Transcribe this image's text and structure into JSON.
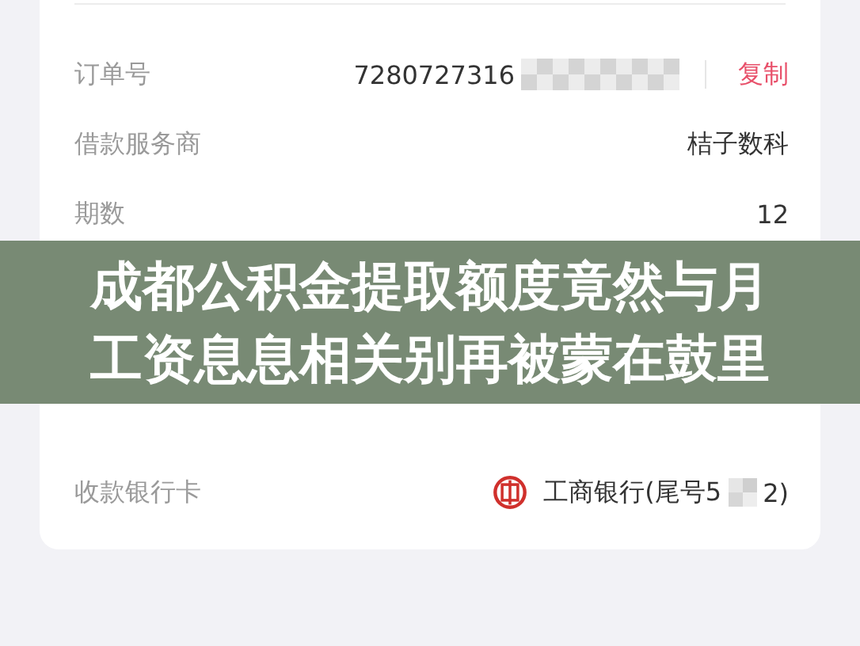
{
  "order_details": {
    "rows": [
      {
        "kind": "order",
        "label": "订单号",
        "value": "7280727316",
        "action": "复制"
      },
      {
        "kind": "text",
        "label": "借款服务商",
        "value": "桔子数科"
      },
      {
        "kind": "text",
        "label": "期数",
        "value": "12"
      },
      {
        "kind": "hidden"
      },
      {
        "kind": "hidden"
      },
      {
        "kind": "hidden"
      },
      {
        "kind": "bank",
        "label": "收款银行卡",
        "value": "工商银行(尾号5",
        "value_end": "2)"
      }
    ]
  },
  "headline": "成都公积金提取额度竟然与月工资息息相关别再被蒙在鼓里"
}
